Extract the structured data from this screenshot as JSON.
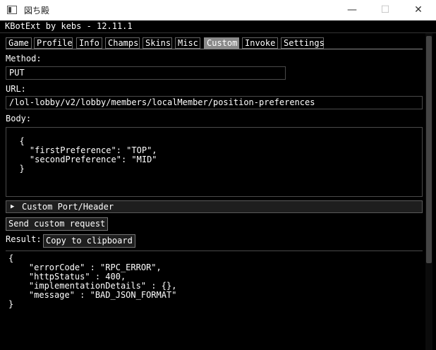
{
  "window": {
    "title": "図ち殿"
  },
  "controls": {
    "minimize": "—",
    "maximize": "☐",
    "close": "✕"
  },
  "app": {
    "title": "KBotExt by kebs - 12.11.1"
  },
  "tabs": [
    {
      "label": "Game"
    },
    {
      "label": "Profile"
    },
    {
      "label": "Info"
    },
    {
      "label": "Champs"
    },
    {
      "label": "Skins"
    },
    {
      "label": "Misc"
    },
    {
      "label": "Custom"
    },
    {
      "label": "Invoke"
    },
    {
      "label": "Settings"
    }
  ],
  "active_tab": "Custom",
  "method": {
    "label": "Method:",
    "value": "PUT"
  },
  "url": {
    "label": "URL:",
    "value": "/lol-lobby/v2/lobby/members/localMember/position-preferences"
  },
  "body": {
    "label": "Body:",
    "value": "  {\n    \"firstPreference\": \"TOP\",\n    \"secondPreference\": \"MID\"\n  }"
  },
  "custom_port_header": {
    "label": "Custom Port/Header",
    "arrow": "▶"
  },
  "send_button": "Send custom request",
  "result": {
    "label": "Result:",
    "copy_button": "Copy to clipboard",
    "value": "{\n    \"errorCode\" : \"RPC_ERROR\",\n    \"httpStatus\" : 400,\n    \"implementationDetails\" : {},\n    \"message\" : \"BAD_JSON_FORMAT\"\n}"
  }
}
